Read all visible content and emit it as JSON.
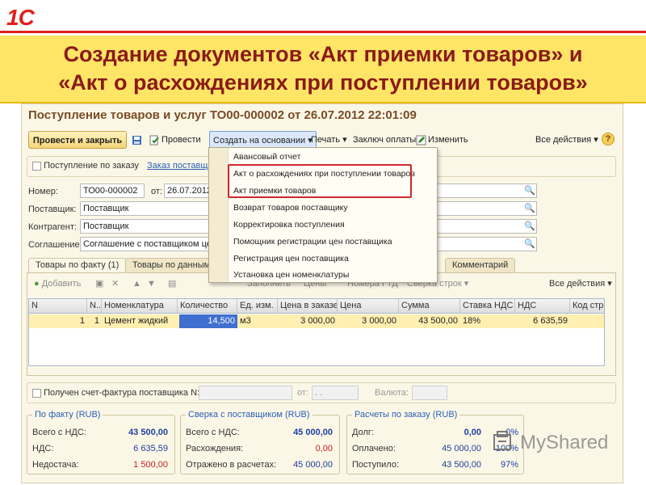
{
  "logo": "1С",
  "slide": {
    "title_line1": "Создание документов «Акт приемки товаров» и",
    "title_line2": "«Акт о расхождениях при поступлении товаров»"
  },
  "window": {
    "title": "Поступление товаров и услуг ТО00-000002 от 26.07.2012 22:01:09"
  },
  "toolbar": {
    "post_close": "Провести и закрыть",
    "post": "Провести",
    "create_based": "Создать на основании",
    "print": "Печать",
    "payment": "Заключ оплаты",
    "edit": "Изменить",
    "all_actions": "Все действия",
    "help": "?"
  },
  "order_row": {
    "checkbox_label": "Поступление по заказу",
    "order_link": "Заказ поставщи..."
  },
  "form": {
    "number_label": "Номер:",
    "number_value": "ТО00-000002",
    "date_label": "от:",
    "date_value": "26.07.2012",
    "supplier_label": "Поставщик:",
    "supplier_value": "Поставщик",
    "counterparty_label": "Контрагент:",
    "counterparty_value": "Поставщик",
    "agreement_label": "Соглашение:",
    "agreement_value": "Соглашение с поставщиком це..."
  },
  "tabs": [
    {
      "label": "Товары по факту (1)"
    },
    {
      "label": "Товары по данным п..."
    },
    {
      "label": "Комментарий"
    }
  ],
  "goods_toolbar": {
    "add": "Добавить",
    "fill": "Заполнить",
    "prices": "Цены",
    "gtd": "Номера ГТД",
    "check": "Сверка строк",
    "all_actions": "Все действия"
  },
  "table": {
    "headers": [
      "N",
      "N...",
      "Номенклатура",
      "Количество",
      "Ед. изм.",
      "Цена в заказе",
      "Цена",
      "Сумма",
      "Ставка НДС",
      "НДС",
      "Код стр"
    ],
    "rows": [
      [
        "1",
        "1",
        "Цемент жидкий",
        "14,500",
        "м3",
        "3 000,00",
        "3 000,00",
        "43 500,00",
        "18%",
        "6 635,59",
        ""
      ]
    ]
  },
  "invoice": {
    "checkbox_label": "Получен счет-фактура поставщика N:",
    "from_label": "от:",
    "date_placeholder": ". .",
    "currency_label": "Валюта:"
  },
  "summary_fact": {
    "title": "По факту (RUB)",
    "total_label": "Всего с НДС:",
    "total_value": "43 500,00",
    "vat_label": "НДС:",
    "vat_value": "6 635,59",
    "shortage_label": "Недостача:",
    "shortage_value": "1 500,00"
  },
  "summary_supplier": {
    "title": "Сверка с поставщиком (RUB)",
    "total_label": "Всего с НДС:",
    "total_value": "45 000,00",
    "diff_label": "Расхождения:",
    "diff_value": "0,00",
    "reflected_label": "Отражено в расчетах:",
    "reflected_value": "45 000,00"
  },
  "summary_order": {
    "title": "Расчеты по заказу (RUB)",
    "debt_label": "Долг:",
    "debt_value": "0,00",
    "debt_pct": "0%",
    "paid_label": "Оплачено:",
    "paid_value": "45 000,00",
    "paid_pct": "100%",
    "received_label": "Поступило:",
    "received_value": "43 500,00",
    "received_pct": "97%"
  },
  "dropdown": {
    "items": [
      "Авансовый отчет",
      "Акт о расхождениях при поступлении товаров",
      "Акт приемки товаров",
      "Возврат товаров поставщику",
      "Корректировка поступления",
      "Помощник регистрации цен поставщика",
      "Регистрация цен поставщика",
      "Установка цен номенклатуры"
    ]
  },
  "watermark": "MyShared"
}
